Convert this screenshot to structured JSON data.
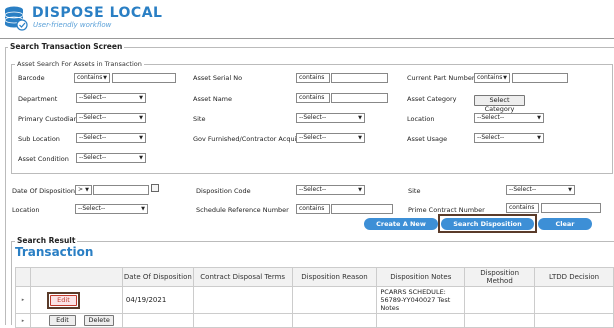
{
  "app": {
    "title": "DISPOSE LOCAL",
    "subtitle": "User-friendly workflow"
  },
  "screen": {
    "legend": "Search Transaction Screen"
  },
  "asset_search": {
    "legend": "Asset Search For Assets in Transaction",
    "barcode": {
      "label": "Barcode",
      "op": "contains"
    },
    "serial": {
      "label": "Asset Serial No",
      "op": "contains"
    },
    "part": {
      "label": "Current Part Number",
      "op": "contains"
    },
    "department": {
      "label": "Department",
      "value": "--Select--"
    },
    "asset_name": {
      "label": "Asset Name",
      "op": "contains"
    },
    "category": {
      "label": "Asset Category",
      "button": "Select Category"
    },
    "custodian": {
      "label": "Primary Custodian",
      "value": "--Select--"
    },
    "site": {
      "label": "Site",
      "value": "--Select--"
    },
    "location": {
      "label": "Location",
      "value": "--Select--"
    },
    "sub_location": {
      "label": "Sub Location",
      "value": "--Select--"
    },
    "gov": {
      "label": "Gov Furnished/Contractor Acquired",
      "value": "--Select--"
    },
    "usage": {
      "label": "Asset Usage",
      "value": "--Select--"
    },
    "condition": {
      "label": "Asset Condition",
      "value": "--Select--"
    }
  },
  "disposition": {
    "date": {
      "label": "Date Of Disposition",
      "op": ">"
    },
    "code": {
      "label": "Disposition Code",
      "value": "--Select--"
    },
    "site": {
      "label": "Site",
      "value": "--Select--"
    },
    "location": {
      "label": "Location",
      "value": "--Select--"
    },
    "schedule": {
      "label": "Schedule Reference Number",
      "op": "contains"
    },
    "prime": {
      "label": "Prime Contract Number",
      "op": "contains"
    }
  },
  "actions": {
    "create": "Create A New Disposition",
    "search": "Search Disposition Transactions",
    "clear": "Clear Dispositions"
  },
  "result": {
    "legend": "Search Result",
    "title": "Transaction",
    "columns": [
      "Date Of Disposition",
      "Contract Disposal Terms",
      "Disposition Reason",
      "Disposition Notes",
      "Disposition Method",
      "LTDD Decision"
    ],
    "rows": [
      {
        "edit": "Edit",
        "date": "04/19/2021",
        "notes": "PCARRS SCHEDULE: 56789-YY040027 Test Notes"
      }
    ],
    "footer": {
      "edit": "Edit",
      "delete": "Delete"
    }
  },
  "colors": {
    "brand": "#2a7fc4",
    "action_blue": "#3d8fd6",
    "highlight": "#5a3b2a",
    "edit_red": "#c0392b"
  }
}
